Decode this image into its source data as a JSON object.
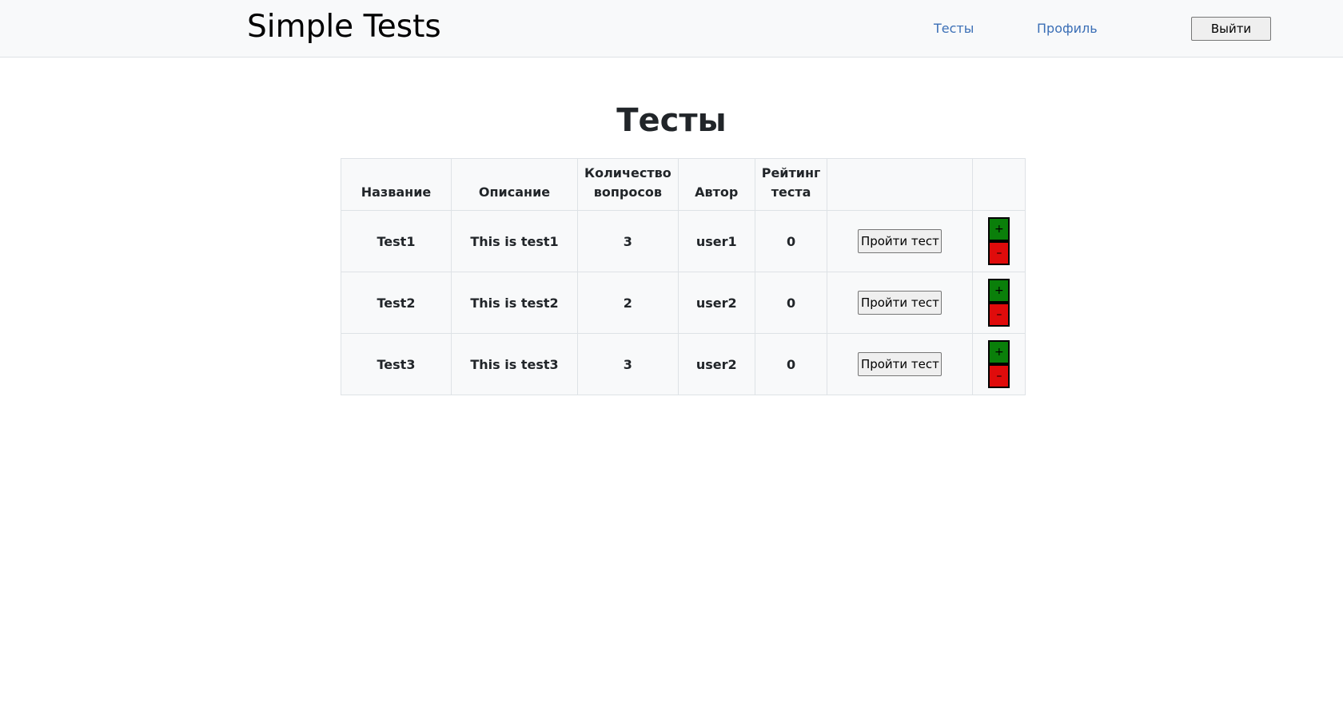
{
  "navbar": {
    "brand": "Simple Tests",
    "links": [
      "Тесты",
      "Профиль"
    ],
    "logout_label": "Выйти"
  },
  "main": {
    "title": "Тесты",
    "columns": [
      "Название",
      "Описание",
      "Количество вопросов",
      "Автор",
      "Рейтинг теста",
      "",
      ""
    ],
    "rows": [
      {
        "name": "Test1",
        "description": "This is test1",
        "questions": "3",
        "author": "user1",
        "rating": "0",
        "action_label": "Пройти тест",
        "upvote": "+",
        "downvote": "–"
      },
      {
        "name": "Test2",
        "description": "This is test2",
        "questions": "2",
        "author": "user2",
        "rating": "0",
        "action_label": "Пройти тест",
        "upvote": "+",
        "downvote": "–"
      },
      {
        "name": "Test3",
        "description": "This is test3",
        "questions": "3",
        "author": "user2",
        "rating": "0",
        "action_label": "Пройти тест",
        "upvote": "+",
        "downvote": "–"
      }
    ]
  },
  "colors": {
    "navbar_bg": "#f8f9fa",
    "link": "#3b6fb6",
    "upvote": "#0a7f0a",
    "downvote": "#e00b0b"
  }
}
